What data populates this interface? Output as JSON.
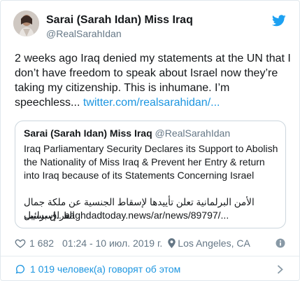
{
  "author": {
    "name": "Sarai (Sarah Idan) Miss Iraq",
    "handle": "@RealSarahIdan"
  },
  "tweet": {
    "text": "2 weeks ago Iraq denied my statements at the UN that I don’t have freedom to speak about Israel now they’re taking my citizenship. This is inhumane. I’m speechless... ",
    "link": "twitter.com/realsarahidan/..."
  },
  "quoted": {
    "name": "Sarai (Sarah Idan) Miss Iraq",
    "handle": "@RealSarahIdan",
    "text": "Iraq Parliamentary Security Declares its Support to Abolish the Nationality of Miss Iraq & Prevent her Entry & return into Iraq because of its Statements Concerning Israel",
    "arabic_line1": "الأمن البرلمانية تعلن تأييدها لإسقاط الجنسية عن ملكة جمال العراق بسبب",
    "arabic_line2_word": "إسرائيل..",
    "arabic_line2_link": " baghdadtoday.news/ar/news/89797/..."
  },
  "meta": {
    "likes": "1 682",
    "timestamp": "01:24 - 10 июл. 2019 г.",
    "location": "Los Angeles, CA"
  },
  "footer": {
    "talking": "1 019 человек(а) говорят об этом"
  },
  "colors": {
    "link": "#1b95e0",
    "secondary": "#657786",
    "border": "#e1e8ed"
  },
  "icons": [
    "twitter-bird-icon",
    "heart-icon",
    "location-icon",
    "info-icon",
    "comment-bubble-icon",
    "chevron-right-icon"
  ]
}
